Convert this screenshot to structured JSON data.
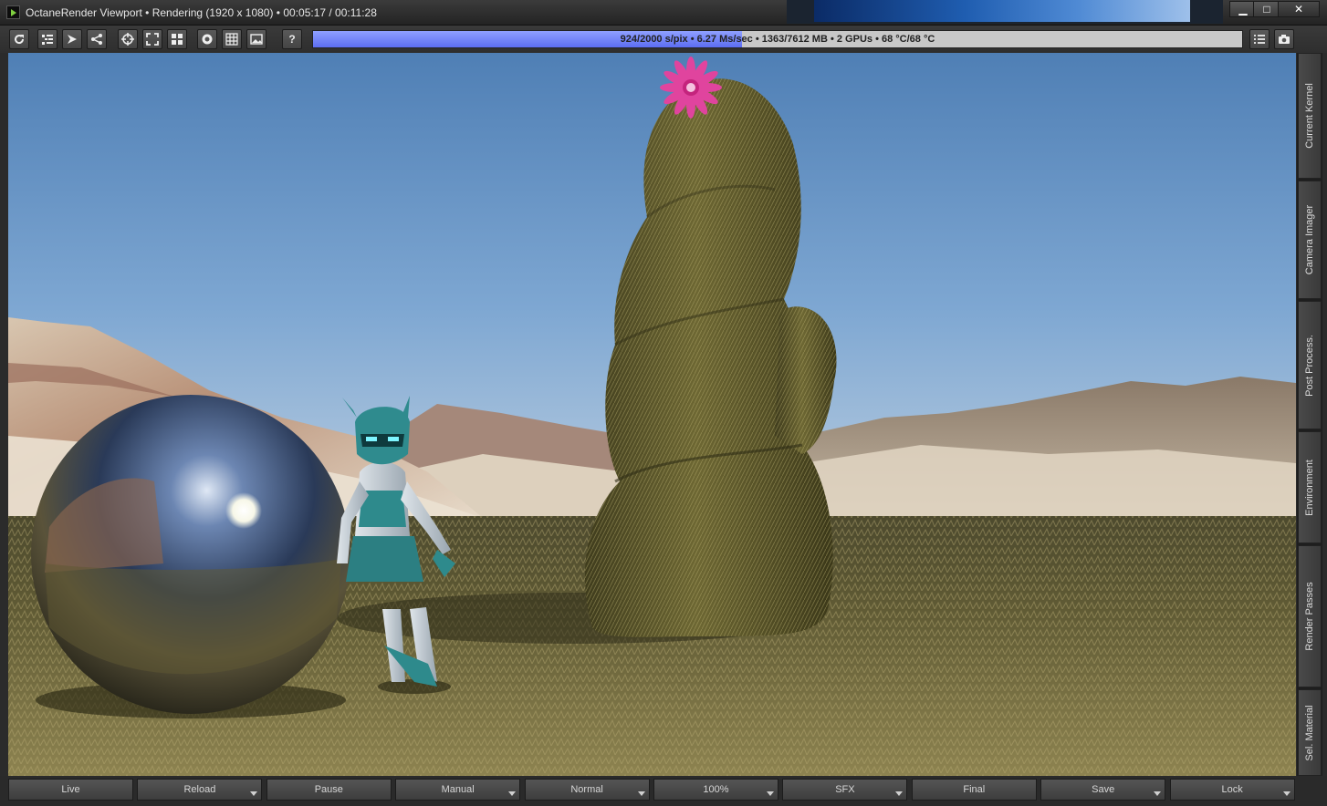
{
  "window": {
    "title": "OctaneRender Viewport • Rendering (1920 x 1080) • 00:05:17 / 00:11:28",
    "minimize_label": "▁",
    "maximize_label": "□",
    "close_label": "✕"
  },
  "toolbar": {
    "buttons": [
      {
        "name": "restart-render-button",
        "icon": "refresh-icon"
      },
      {
        "name": "node-graph-button",
        "icon": "tree-icon"
      },
      {
        "name": "send-scene-button",
        "icon": "send-icon"
      },
      {
        "name": "share-button",
        "icon": "share-icon"
      },
      {
        "name": "pick-focus-button",
        "icon": "crosshair-icon"
      },
      {
        "name": "region-render-button",
        "icon": "region-icon"
      },
      {
        "name": "layout-button",
        "icon": "grid-icon"
      },
      {
        "name": "stop-button",
        "icon": "circle-icon"
      },
      {
        "name": "film-region-button",
        "icon": "table-icon"
      },
      {
        "name": "image-button",
        "icon": "image-icon"
      },
      {
        "name": "help-button",
        "icon": "help-icon"
      }
    ],
    "help_label": "?",
    "progress_text": "924/2000 s/pix • 6.27 Ms/sec • 1363/7612 MB • 2 GPUs • 68 °C/68 °C",
    "progress_fraction": 0.462,
    "progress_color": "#6675f5"
  },
  "sidetabs": [
    "Current Kernel",
    "Camera Imager",
    "Post Process.",
    "Environment",
    "Render Passes",
    "Sel. Material"
  ],
  "bottom_buttons": [
    {
      "label": "Live",
      "dropdown": false
    },
    {
      "label": "Reload",
      "dropdown": true
    },
    {
      "label": "Pause",
      "dropdown": false
    },
    {
      "label": "Manual",
      "dropdown": true
    },
    {
      "label": "Normal",
      "dropdown": true
    },
    {
      "label": "100%",
      "dropdown": true
    },
    {
      "label": "SFX",
      "dropdown": true
    },
    {
      "label": "Final",
      "dropdown": false
    },
    {
      "label": "Save",
      "dropdown": true
    },
    {
      "label": "Lock",
      "dropdown": true
    }
  ],
  "render": {
    "scene": "desert-cactus-robot-sphere",
    "sky_color": "#5e8fc6",
    "ground_color": "#5f5a34",
    "cactus_color": "#5b5727",
    "flower_color": "#e0449e"
  }
}
